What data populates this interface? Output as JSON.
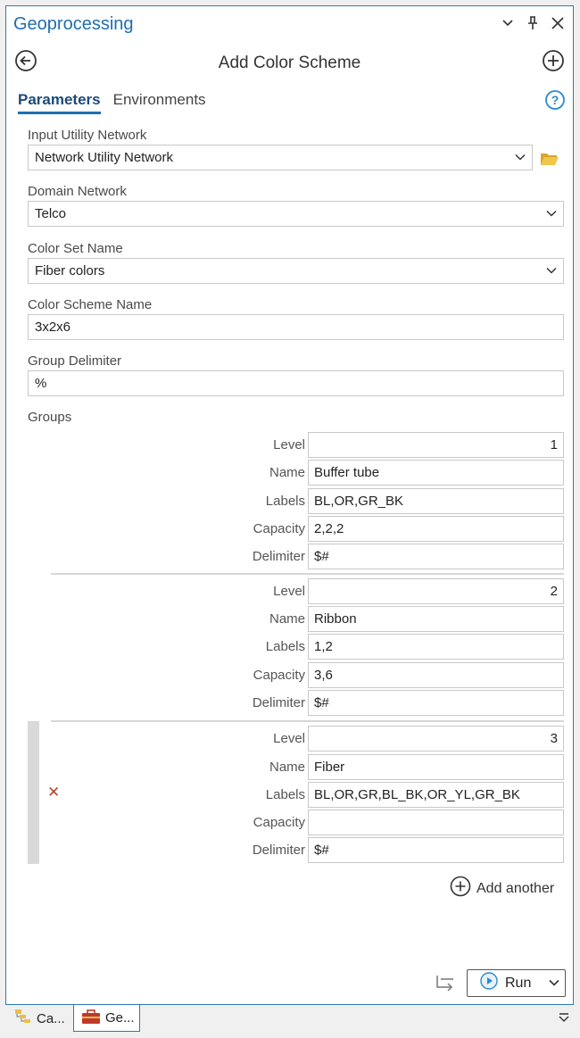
{
  "pane": {
    "title": "Geoprocessing"
  },
  "header": {
    "title": "Add Color Scheme"
  },
  "tabs": [
    {
      "label": "Parameters",
      "active": true
    },
    {
      "label": "Environments",
      "active": false
    }
  ],
  "params": {
    "input_utility_network": {
      "label": "Input Utility Network",
      "value": "Network Utility Network"
    },
    "domain_network": {
      "label": "Domain Network",
      "value": "Telco"
    },
    "color_set_name": {
      "label": "Color Set Name",
      "value": "Fiber colors"
    },
    "color_scheme_name": {
      "label": "Color Scheme Name",
      "value": "3x2x6"
    },
    "group_delimiter": {
      "label": "Group Delimiter",
      "value": "%"
    },
    "groups_label": "Groups"
  },
  "group_field_labels": {
    "level": "Level",
    "name": "Name",
    "labels": "Labels",
    "capacity": "Capacity",
    "delimiter": "Delimiter"
  },
  "groups": [
    {
      "level": "1",
      "name": "Buffer tube",
      "labels": "BL,OR,GR_BK",
      "capacity": "2,2,2",
      "delimiter": "$#"
    },
    {
      "level": "2",
      "name": "Ribbon",
      "labels": "1,2",
      "capacity": "3,6",
      "delimiter": "$#"
    },
    {
      "level": "3",
      "name": "Fiber",
      "labels": "BL,OR,GR,BL_BK,OR_YL,GR_BK",
      "capacity": "",
      "delimiter": "$#"
    }
  ],
  "add_another_label": "Add another",
  "run_label": "Run",
  "bottom_tabs": [
    {
      "label": "Ca...",
      "active": false
    },
    {
      "label": "Ge...",
      "active": true
    }
  ],
  "colors": {
    "accent": "#1d6fb3",
    "border": "#2a7ab8",
    "remove": "#b5472a",
    "folder": "#e0b43a"
  }
}
